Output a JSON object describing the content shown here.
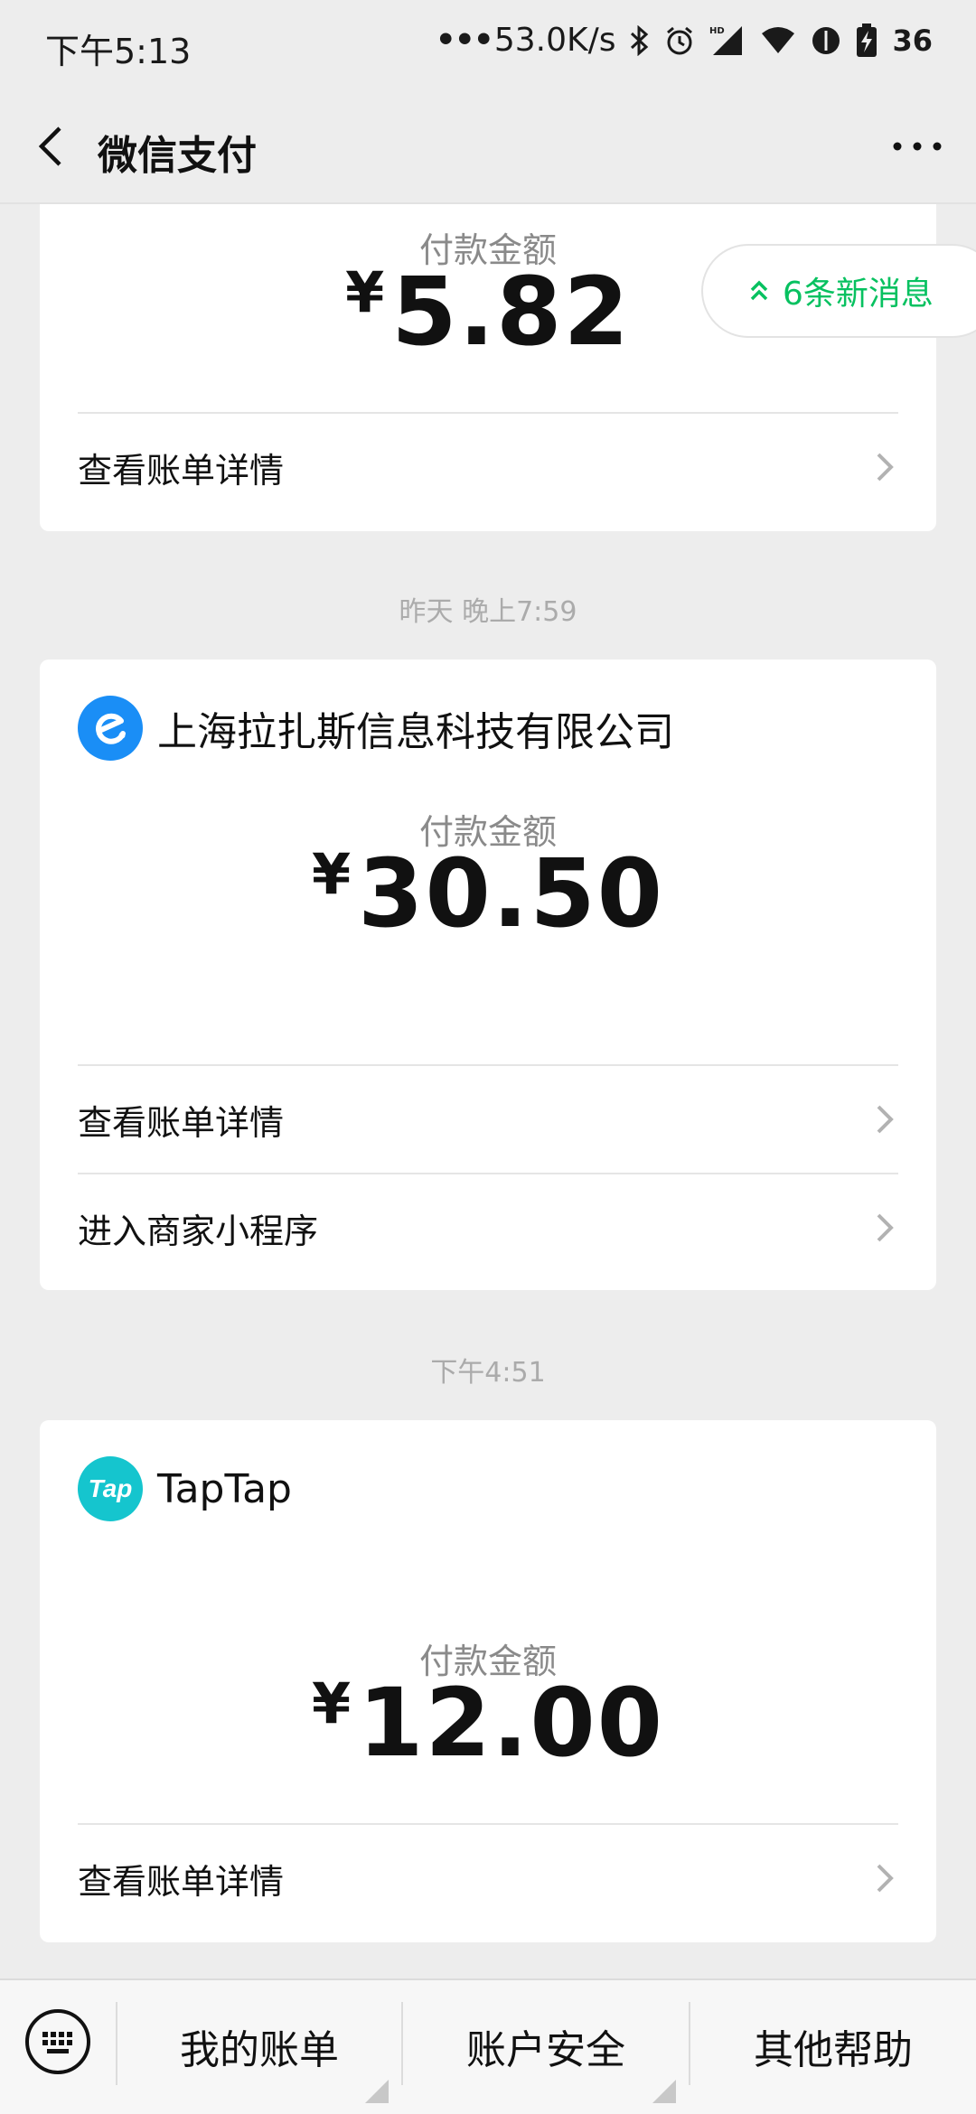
{
  "status_bar": {
    "time": "下午5:13",
    "network_speed": "53.0K/s",
    "battery": "36"
  },
  "nav": {
    "title": "微信支付"
  },
  "new_messages": {
    "label": "6条新消息",
    "color": "#07c160"
  },
  "messages": [
    {
      "pay_label": "付款金额",
      "currency": "¥",
      "amount": "5.82",
      "rows": [
        "查看账单详情"
      ]
    },
    {
      "timestamp": "昨天 晚上7:59",
      "merchant": "上海拉扎斯信息科技有限公司",
      "logo": "eleme-logo",
      "logo_color": "#1a8ef6",
      "pay_label": "付款金额",
      "currency": "¥",
      "amount": "30.50",
      "rows": [
        "查看账单详情",
        "进入商家小程序"
      ]
    },
    {
      "timestamp": "下午4:51",
      "merchant": "TapTap",
      "logo": "taptap-logo",
      "logo_text": "Tap",
      "logo_color": "#15c5ce",
      "pay_label": "付款金额",
      "currency": "¥",
      "amount": "12.00",
      "rows": [
        "查看账单详情"
      ]
    }
  ],
  "bottom_menu": {
    "items": [
      "我的账单",
      "账户安全",
      "其他帮助"
    ]
  }
}
